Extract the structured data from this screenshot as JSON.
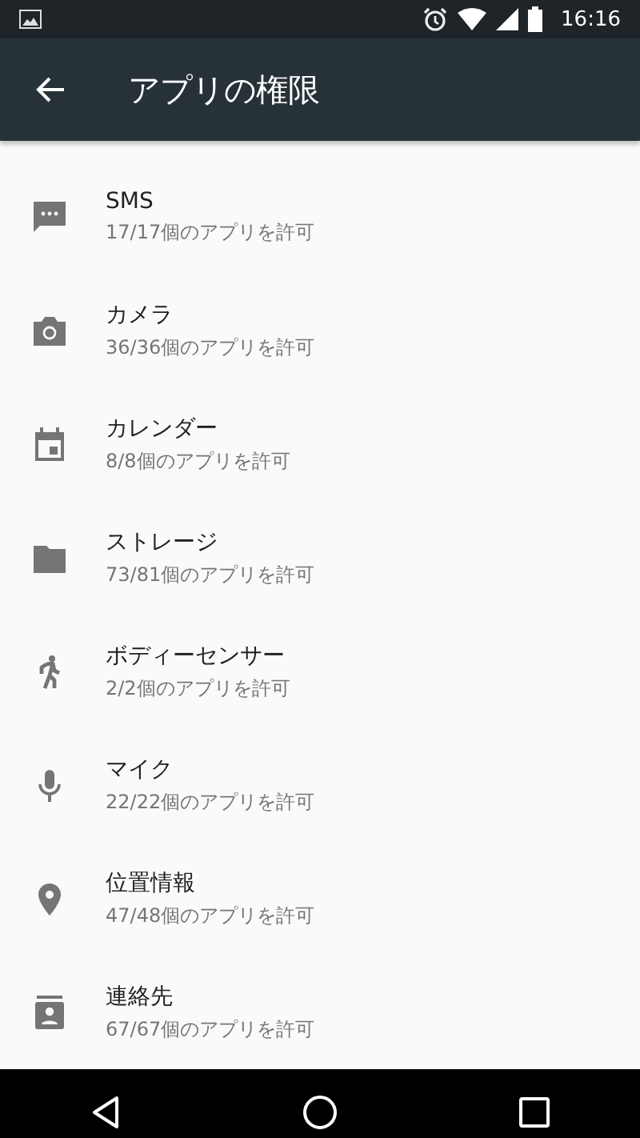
{
  "status_bar": {
    "time": "16:16"
  },
  "toolbar": {
    "title": "アプリの権限"
  },
  "permissions": [
    {
      "name": "SMS",
      "summary": "17/17個のアプリを許可"
    },
    {
      "name": "カメラ",
      "summary": "36/36個のアプリを許可"
    },
    {
      "name": "カレンダー",
      "summary": "8/8個のアプリを許可"
    },
    {
      "name": "ストレージ",
      "summary": "73/81個のアプリを許可"
    },
    {
      "name": "ボディーセンサー",
      "summary": "2/2個のアプリを許可"
    },
    {
      "name": "マイク",
      "summary": "22/22個のアプリを許可"
    },
    {
      "name": "位置情報",
      "summary": "47/48個のアプリを許可"
    },
    {
      "name": "連絡先",
      "summary": "67/67個のアプリを許可"
    }
  ]
}
